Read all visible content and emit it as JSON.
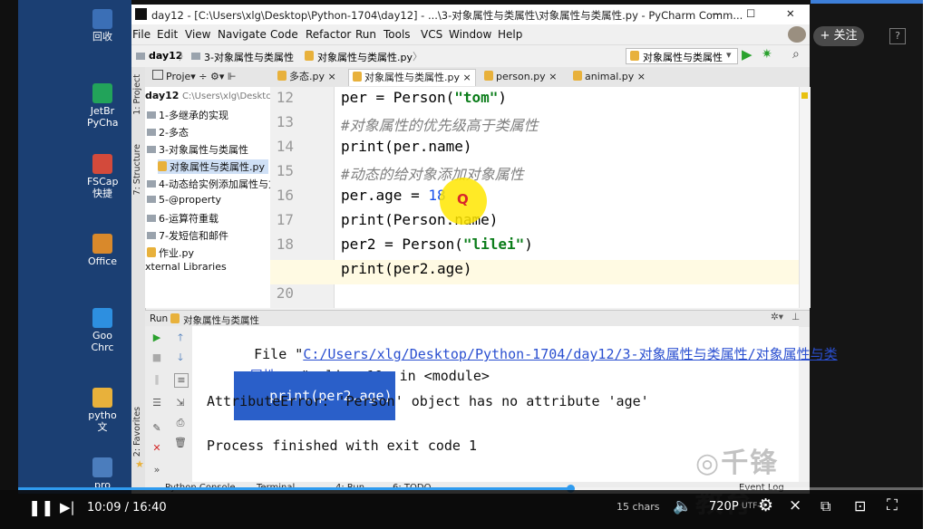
{
  "window": {
    "title": "day12 - [C:\\Users\\xlg\\Desktop\\Python-1704\\day12] - ...\\3-对象属性与类属性\\对象属性与类属性.py - PyCharm Comm...",
    "min": "—",
    "max": "☐",
    "close": "✕"
  },
  "menu": [
    "File",
    "Edit",
    "View",
    "Navigate",
    "Code",
    "Refactor",
    "Run",
    "Tools",
    "VCS",
    "Window",
    "Help"
  ],
  "nav": {
    "crumbs": [
      "day12",
      "3-对象属性与类属性",
      "对象属性与类属性.py"
    ],
    "run_config": "对象属性与类属性"
  },
  "tabs": [
    {
      "label": "多态.py",
      "active": false
    },
    {
      "label": "对象属性与类属性.py",
      "active": true
    },
    {
      "label": "person.py",
      "active": false
    },
    {
      "label": "animal.py",
      "active": false
    }
  ],
  "project": {
    "header": "Proje",
    "root": "day12",
    "root_path": "C:\\Users\\xlg\\Desktc",
    "items": [
      {
        "label": "1-多继承的实现",
        "type": "folder"
      },
      {
        "label": "2-多态",
        "type": "folder"
      },
      {
        "label": "3-对象属性与类属性",
        "type": "folder"
      },
      {
        "label": "对象属性与类属性.py",
        "type": "file"
      },
      {
        "label": "4-动态给实例添加属性与方",
        "type": "folder"
      },
      {
        "label": "5-@property",
        "type": "folder"
      },
      {
        "label": "6-运算符重载",
        "type": "folder"
      },
      {
        "label": "7-发短信和邮件",
        "type": "folder"
      },
      {
        "label": "作业.py",
        "type": "file"
      }
    ],
    "external": "xternal Libraries"
  },
  "side_labels": {
    "project": "1: Project",
    "structure": "7: Structure",
    "favorites": "2: Favorites"
  },
  "editor": {
    "lines": [
      {
        "num": "12",
        "text": "per = Person(\"tom\")"
      },
      {
        "num": "13",
        "text": "#对象属性的优先级高于类属性"
      },
      {
        "num": "14",
        "text": "print(per.name)"
      },
      {
        "num": "15",
        "text": "#动态的给对象添加对象属性"
      },
      {
        "num": "16",
        "text": "per.age = 18"
      },
      {
        "num": "17",
        "text": "print(Person.name)"
      },
      {
        "num": "18",
        "text": "per2 = Person(\"lilei\")"
      },
      {
        "num": "19",
        "text": "print(per2.age)"
      },
      {
        "num": "20",
        "text": ""
      }
    ]
  },
  "run": {
    "label": "Run",
    "config": "对象属性与类属性",
    "output": {
      "file_prefix": "File \"",
      "file_path": "C:/Users/xlg/Desktop/Python-1704/day12/3-对象属性与类属性/对象属性与类",
      "file_path_2": "属性.py",
      "file_suffix": "\", line 19, in <module>",
      "code": "print(per2.age)",
      "error": "AttributeError: 'Person' object has no attribute 'age'",
      "exit": "Process finished with exit code 1"
    }
  },
  "bottom_tabs": [
    "Python Console",
    "Terminal",
    "4: Run",
    "6: TODO"
  ],
  "status": {
    "event_log": "Event Log",
    "chars": "15 chars",
    "extra": "UTF-8"
  },
  "desktop_icons": [
    {
      "label": "回收",
      "color": "#3b6fb6"
    },
    {
      "label": "JetBr PyCha",
      "color": "#22a35a"
    },
    {
      "label": "FSCap 快捷",
      "color": "#d34a3b"
    },
    {
      "label": "Office",
      "color": "#d9892b"
    },
    {
      "label": "Goo Chrc",
      "color": "#2d8fe0"
    },
    {
      "label": "pytho 文",
      "color": "#e8b13b"
    },
    {
      "label": "pro",
      "color": "#4b7dbd"
    }
  ],
  "follow": {
    "label": "+ 关注"
  },
  "watermark": "千锋教育",
  "player": {
    "time_current": "10:09",
    "time_total": "16:40",
    "time_sep": "/",
    "quality": "720P",
    "progress": 0.61
  }
}
